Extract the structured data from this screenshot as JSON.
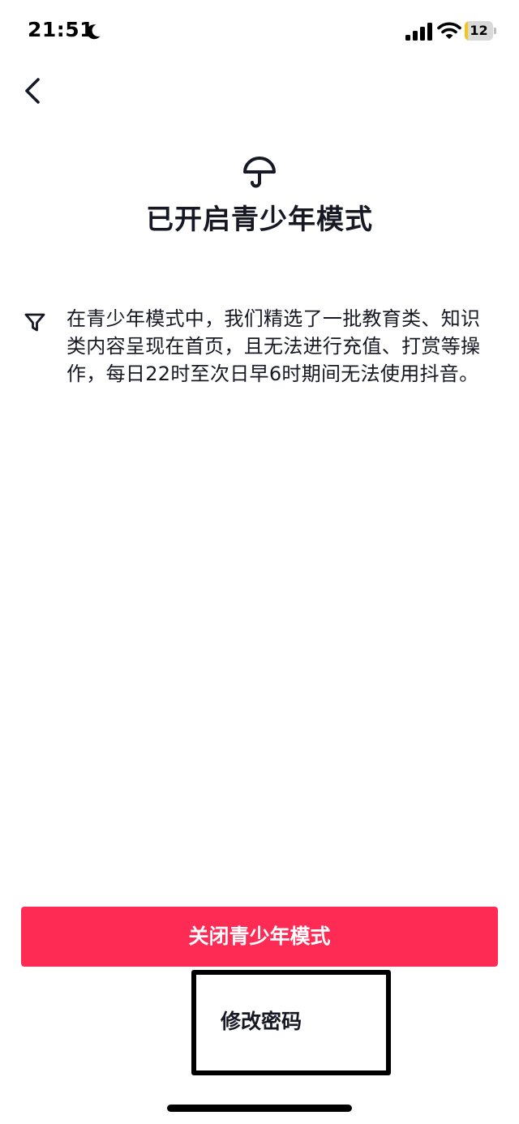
{
  "status_bar": {
    "time": "21:51",
    "battery_level": "12",
    "battery_fraction": 0.12,
    "icons": [
      "moon-icon",
      "signal-icon",
      "wifi-icon",
      "battery-icon"
    ]
  },
  "nav": {
    "back_icon": "chevron-left-icon"
  },
  "hero": {
    "icon": "umbrella-icon",
    "title": "已开启青少年模式"
  },
  "description": {
    "icon": "filter-icon",
    "text": "在青少年模式中，我们精选了一批教育类、知识类内容呈现在首页，且无法进行充值、打赏等操作，每日22时至次日早6时期间无法使用抖音。"
  },
  "actions": {
    "close_mode_label": "关闭青少年模式",
    "change_password_label": "修改密码"
  },
  "colors": {
    "accent": "#fe2c55",
    "text": "#161823",
    "battery_low": "#f5c518"
  }
}
